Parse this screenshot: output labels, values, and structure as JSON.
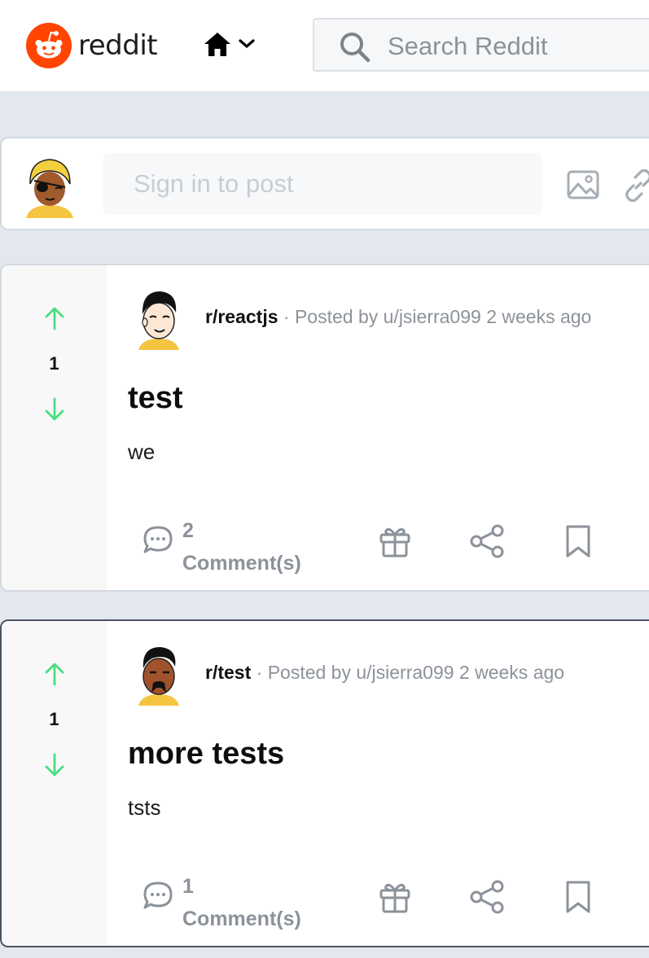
{
  "header": {
    "logo_text": "reddit",
    "search_placeholder": "Search Reddit"
  },
  "create_post": {
    "placeholder": "Sign in to post"
  },
  "posts": [
    {
      "votes": "1",
      "subreddit": "r/reactjs",
      "posted_by": "· Posted by u/jsierra099 2 weeks ago",
      "title": "test",
      "body": "we",
      "comment_count": "2",
      "comment_label": "Comment(s)"
    },
    {
      "votes": "1",
      "subreddit": "r/test",
      "posted_by": "· Posted by u/jsierra099 2 weeks ago",
      "title": "more tests",
      "body": "tsts",
      "comment_count": "1",
      "comment_label": "Comment(s)"
    }
  ],
  "colors": {
    "brand": "#ff4500",
    "vote_arrow": "#4ade80",
    "muted_text": "#8c929a",
    "page_bg": "#e3e8ee"
  },
  "icons": [
    "reddit-logo-icon",
    "home-icon",
    "chevron-down-icon",
    "search-icon",
    "image-icon",
    "link-icon",
    "upvote-icon",
    "downvote-icon",
    "comment-icon",
    "gift-icon",
    "share-icon",
    "bookmark-icon"
  ]
}
